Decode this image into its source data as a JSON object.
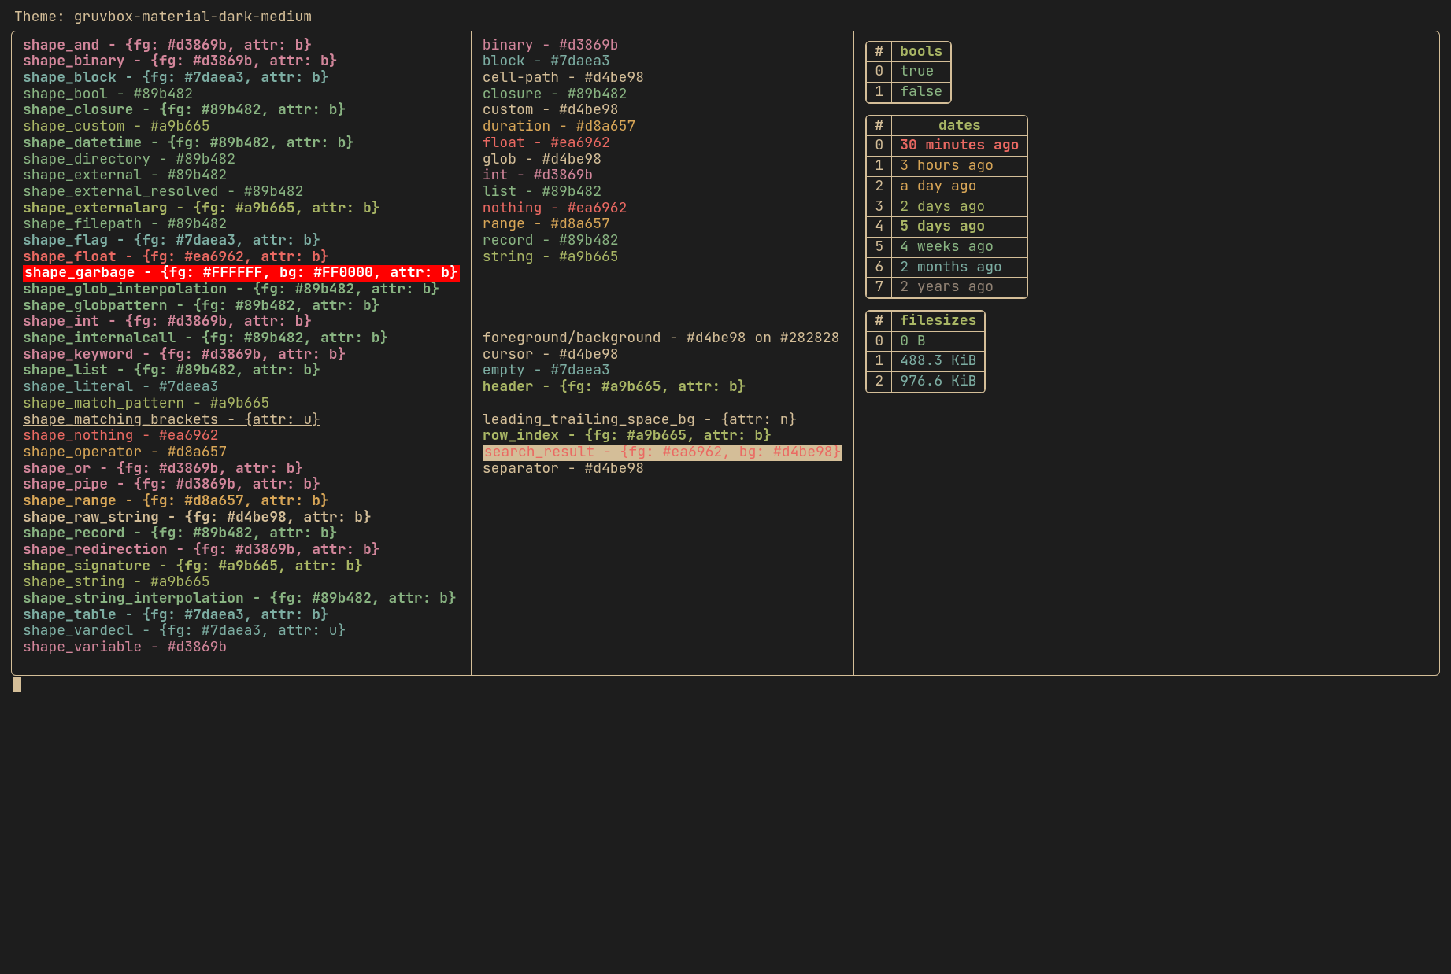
{
  "title_prefix": "Theme: ",
  "theme_name": "gruvbox-material-dark-medium",
  "shapes": [
    {
      "name": "shape_and",
      "value": "{fg: #d3869b, attr: b}",
      "color": "#d3869b",
      "bold": true
    },
    {
      "name": "shape_binary",
      "value": "{fg: #d3869b, attr: b}",
      "color": "#d3869b",
      "bold": true
    },
    {
      "name": "shape_block",
      "value": "{fg: #7daea3, attr: b}",
      "color": "#7daea3",
      "bold": true
    },
    {
      "name": "shape_bool",
      "value": "#89b482",
      "color": "#89b482",
      "bold": false
    },
    {
      "name": "shape_closure",
      "value": "{fg: #89b482, attr: b}",
      "color": "#89b482",
      "bold": true
    },
    {
      "name": "shape_custom",
      "value": "#a9b665",
      "color": "#a9b665",
      "bold": false
    },
    {
      "name": "shape_datetime",
      "value": "{fg: #89b482, attr: b}",
      "color": "#89b482",
      "bold": true
    },
    {
      "name": "shape_directory",
      "value": "#89b482",
      "color": "#89b482",
      "bold": false
    },
    {
      "name": "shape_external",
      "value": "#89b482",
      "color": "#89b482",
      "bold": false
    },
    {
      "name": "shape_external_resolved",
      "value": "#89b482",
      "color": "#89b482",
      "bold": false
    },
    {
      "name": "shape_externalarg",
      "value": "{fg: #a9b665, attr: b}",
      "color": "#a9b665",
      "bold": true
    },
    {
      "name": "shape_filepath",
      "value": "#89b482",
      "color": "#89b482",
      "bold": false
    },
    {
      "name": "shape_flag",
      "value": "{fg: #7daea3, attr: b}",
      "color": "#7daea3",
      "bold": true
    },
    {
      "name": "shape_float",
      "value": "{fg: #ea6962, attr: b}",
      "color": "#ea6962",
      "bold": true
    },
    {
      "name": "shape_garbage",
      "value": "{fg: #FFFFFF, bg: #FF0000, attr: b}",
      "garbage": true
    },
    {
      "name": "shape_glob_interpolation",
      "value": "{fg: #89b482, attr: b}",
      "color": "#89b482",
      "bold": true
    },
    {
      "name": "shape_globpattern",
      "value": "{fg: #89b482, attr: b}",
      "color": "#89b482",
      "bold": true
    },
    {
      "name": "shape_int",
      "value": "{fg: #d3869b, attr: b}",
      "color": "#d3869b",
      "bold": true
    },
    {
      "name": "shape_internalcall",
      "value": "{fg: #89b482, attr: b}",
      "color": "#89b482",
      "bold": true
    },
    {
      "name": "shape_keyword",
      "value": "{fg: #d3869b, attr: b}",
      "color": "#d3869b",
      "bold": true
    },
    {
      "name": "shape_list",
      "value": "{fg: #89b482, attr: b}",
      "color": "#89b482",
      "bold": true
    },
    {
      "name": "shape_literal",
      "value": "#7daea3",
      "color": "#7daea3",
      "bold": false
    },
    {
      "name": "shape_match_pattern",
      "value": "#a9b665",
      "color": "#a9b665",
      "bold": false
    },
    {
      "name": "shape_matching_brackets",
      "value": "{attr: u}",
      "color": "#d4be98",
      "bold": false,
      "underline": true
    },
    {
      "name": "shape_nothing",
      "value": "#ea6962",
      "color": "#ea6962",
      "bold": false
    },
    {
      "name": "shape_operator",
      "value": "#d8a657",
      "color": "#d8a657",
      "bold": false
    },
    {
      "name": "shape_or",
      "value": "{fg: #d3869b, attr: b}",
      "color": "#d3869b",
      "bold": true
    },
    {
      "name": "shape_pipe",
      "value": "{fg: #d3869b, attr: b}",
      "color": "#d3869b",
      "bold": true
    },
    {
      "name": "shape_range",
      "value": "{fg: #d8a657, attr: b}",
      "color": "#d8a657",
      "bold": true
    },
    {
      "name": "shape_raw_string",
      "value": "{fg: #d4be98, attr: b}",
      "color": "#d4be98",
      "bold": true
    },
    {
      "name": "shape_record",
      "value": "{fg: #89b482, attr: b}",
      "color": "#89b482",
      "bold": true
    },
    {
      "name": "shape_redirection",
      "value": "{fg: #d3869b, attr: b}",
      "color": "#d3869b",
      "bold": true
    },
    {
      "name": "shape_signature",
      "value": "{fg: #a9b665, attr: b}",
      "color": "#a9b665",
      "bold": true
    },
    {
      "name": "shape_string",
      "value": "#a9b665",
      "color": "#a9b665",
      "bold": false
    },
    {
      "name": "shape_string_interpolation",
      "value": "{fg: #89b482, attr: b}",
      "color": "#89b482",
      "bold": true
    },
    {
      "name": "shape_table",
      "value": "{fg: #7daea3, attr: b}",
      "color": "#7daea3",
      "bold": true
    },
    {
      "name": "shape_vardecl",
      "value": "{fg: #7daea3, attr: u}",
      "color": "#7daea3",
      "bold": false,
      "underline": true
    },
    {
      "name": "shape_variable",
      "value": "#d3869b",
      "color": "#d3869b",
      "bold": false
    }
  ],
  "types": [
    {
      "name": "binary",
      "value": "#d3869b",
      "color": "#d3869b"
    },
    {
      "name": "block",
      "value": "#7daea3",
      "color": "#7daea3"
    },
    {
      "name": "cell-path",
      "value": "#d4be98",
      "color": "#d4be98"
    },
    {
      "name": "closure",
      "value": "#89b482",
      "color": "#89b482"
    },
    {
      "name": "custom",
      "value": "#d4be98",
      "color": "#d4be98"
    },
    {
      "name": "duration",
      "value": "#d8a657",
      "color": "#d8a657"
    },
    {
      "name": "float",
      "value": "#ea6962",
      "color": "#ea6962"
    },
    {
      "name": "glob",
      "value": "#d4be98",
      "color": "#d4be98"
    },
    {
      "name": "int",
      "value": "#d3869b",
      "color": "#d3869b"
    },
    {
      "name": "list",
      "value": "#89b482",
      "color": "#89b482"
    },
    {
      "name": "nothing",
      "value": "#ea6962",
      "color": "#ea6962"
    },
    {
      "name": "range",
      "value": "#d8a657",
      "color": "#d8a657"
    },
    {
      "name": "record",
      "value": "#89b482",
      "color": "#89b482"
    },
    {
      "name": "string",
      "value": "#a9b665",
      "color": "#a9b665"
    }
  ],
  "ui": [
    {
      "name": "foreground/background",
      "value": "#d4be98 on #282828",
      "color": "#d4be98"
    },
    {
      "name": "cursor",
      "value": "#d4be98",
      "color": "#d4be98"
    },
    {
      "name": "empty",
      "value": "#7daea3",
      "color": "#7daea3"
    },
    {
      "name": "header",
      "value": "{fg: #a9b665, attr: b}",
      "color": "#a9b665",
      "bold": true
    }
  ],
  "ui2": [
    {
      "name": "leading_trailing_space_bg",
      "value": "{attr: n}",
      "color": "#d4be98"
    },
    {
      "name": "row_index",
      "value": "{fg: #a9b665, attr: b}",
      "color": "#a9b665",
      "bold": true
    },
    {
      "name": "search_result",
      "value": "{fg: #ea6962, bg: #d4be98}",
      "search": true
    },
    {
      "name": "separator",
      "value": "#d4be98",
      "color": "#d4be98"
    }
  ],
  "tables": {
    "bools": {
      "header_idx": "#",
      "header_val": "bools",
      "rows": [
        {
          "idx": "0",
          "val": "true",
          "color": "#89b482"
        },
        {
          "idx": "1",
          "val": "false",
          "color": "#89b482"
        }
      ]
    },
    "dates": {
      "header_idx": "#",
      "header_val": "dates",
      "rows": [
        {
          "idx": "0",
          "val": "30 minutes ago",
          "color": "#ea6962",
          "bold": true
        },
        {
          "idx": "1",
          "val": "3 hours ago",
          "color": "#d8a657"
        },
        {
          "idx": "2",
          "val": "a day ago",
          "color": "#d8a657"
        },
        {
          "idx": "3",
          "val": "2 days ago",
          "color": "#a9b665"
        },
        {
          "idx": "4",
          "val": "5 days ago",
          "color": "#a9b665",
          "bold": true
        },
        {
          "idx": "5",
          "val": "4 weeks ago",
          "color": "#89b482"
        },
        {
          "idx": "6",
          "val": "2 months ago",
          "color": "#7daea3"
        },
        {
          "idx": "7",
          "val": "2 years ago",
          "color": "#928374"
        }
      ]
    },
    "filesizes": {
      "header_idx": "#",
      "header_val": "filesizes",
      "rows": [
        {
          "idx": "0",
          "val": "    0 B",
          "color": "#89b482"
        },
        {
          "idx": "1",
          "val": "488.3 KiB",
          "color": "#7daea3"
        },
        {
          "idx": "2",
          "val": "976.6 KiB",
          "color": "#7daea3"
        }
      ]
    }
  }
}
